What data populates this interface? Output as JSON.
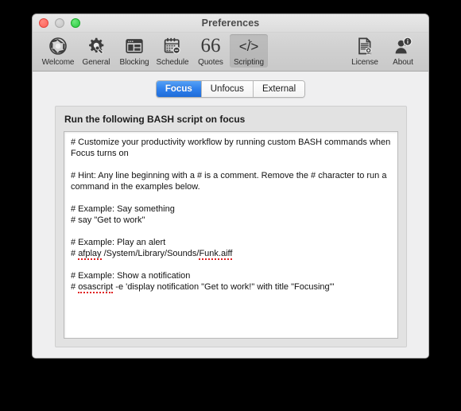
{
  "window": {
    "title": "Preferences",
    "controls": [
      {
        "name": "close",
        "label": "Close",
        "color": "#ff5f57"
      },
      {
        "name": "minimize",
        "label": "Minimize",
        "color": "#c4c4c4"
      },
      {
        "name": "zoom",
        "label": "Zoom",
        "color": "#28c940"
      }
    ]
  },
  "toolbar": {
    "left_items": [
      {
        "label": "Welcome",
        "icon": "aperture-icon"
      },
      {
        "label": "General",
        "icon": "gear-wrench-icon"
      },
      {
        "label": "Blocking",
        "icon": "browser-window-icon"
      },
      {
        "label": "Schedule",
        "icon": "calendar-clock-icon"
      },
      {
        "label": "Quotes",
        "icon": "quotation-marks-icon"
      },
      {
        "label": "Scripting",
        "icon": "code-wand-icon"
      }
    ],
    "right_items": [
      {
        "label": "License",
        "icon": "certificate-seal-icon"
      },
      {
        "label": "About",
        "icon": "person-info-icon"
      }
    ],
    "selected": "Scripting",
    "selected_color": "#b8b8b8"
  },
  "tabs": {
    "items": [
      {
        "label": "Focus"
      },
      {
        "label": "Unfocus"
      },
      {
        "label": "External"
      }
    ],
    "selected": "Focus",
    "selected_color": "#2f80ec"
  },
  "panel": {
    "heading": "Run the following BASH script on focus",
    "script_lines": [
      {
        "text": "# Customize your productivity workflow by running custom BASH commands when"
      },
      {
        "text": "Focus turns on"
      },
      {
        "text": ""
      },
      {
        "text": "# Hint: Any line beginning with a # is a comment. Remove the # character to run a"
      },
      {
        "text": "command in the examples below."
      },
      {
        "text": ""
      },
      {
        "text": "# Example: Say something"
      },
      {
        "text": "# say \"Get to work\""
      },
      {
        "text": ""
      },
      {
        "text": "# Example: Play an alert"
      },
      {
        "text": "# ",
        "segments": [
          {
            "t": "# ",
            "spell": false
          },
          {
            "t": "afplay",
            "spell": true
          },
          {
            "t": " /System/Library/Sounds/",
            "spell": false
          },
          {
            "t": "Funk.aiff",
            "spell": true
          }
        ]
      },
      {
        "text": ""
      },
      {
        "text": "# Example: Show a notification"
      },
      {
        "text": "# ",
        "segments": [
          {
            "t": "# ",
            "spell": false
          },
          {
            "t": "osascript",
            "spell": true
          },
          {
            "t": " -e 'display notification \"Get to work!\" with title \"Focusing\"'",
            "spell": false
          }
        ]
      }
    ]
  }
}
